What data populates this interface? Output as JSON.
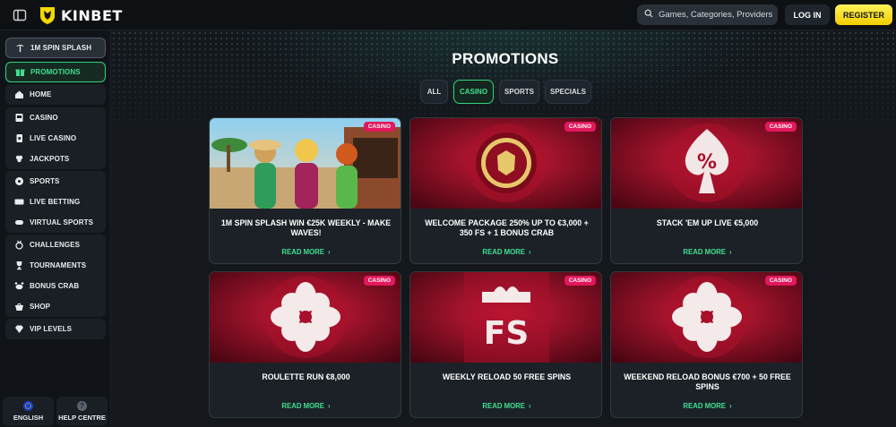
{
  "header": {
    "brand": "KINBET",
    "search_placeholder": "Games, Categories, Providers",
    "login_label": "LOG IN",
    "register_label": "REGISTER"
  },
  "sidebar": {
    "items": [
      {
        "label": "1M SPIN SPLASH",
        "icon": "palm-icon"
      },
      {
        "label": "PROMOTIONS",
        "icon": "gift-icon"
      },
      {
        "label": "HOME",
        "icon": "home-icon"
      },
      {
        "label": "CASINO",
        "icon": "slot-icon"
      },
      {
        "label": "LIVE CASINO",
        "icon": "cards-icon"
      },
      {
        "label": "JACKPOTS",
        "icon": "clover-icon"
      },
      {
        "label": "SPORTS",
        "icon": "ball-icon"
      },
      {
        "label": "LIVE BETTING",
        "icon": "live-icon"
      },
      {
        "label": "VIRTUAL SPORTS",
        "icon": "controller-icon"
      },
      {
        "label": "CHALLENGES",
        "icon": "medal-icon"
      },
      {
        "label": "TOURNAMENTS",
        "icon": "trophy-icon"
      },
      {
        "label": "BONUS CRAB",
        "icon": "crab-icon"
      },
      {
        "label": "SHOP",
        "icon": "basket-icon"
      },
      {
        "label": "VIP LEVELS",
        "icon": "diamond-icon"
      }
    ],
    "footer": {
      "language_label": "ENGLISH",
      "help_label": "HELP CENTRE"
    }
  },
  "main": {
    "title": "PROMOTIONS",
    "filters": [
      "ALL",
      "CASINO",
      "SPORTS",
      "SPECIALS"
    ],
    "active_filter": "CASINO",
    "read_more_label": "READ MORE",
    "cards": [
      {
        "badge": "CASINO",
        "title": "1M SPIN SPLASH WIN €25K WEEKLY - MAKE WAVES!",
        "art": "characters"
      },
      {
        "badge": "CASINO",
        "title": "WELCOME PACKAGE 250% UP TO €3,000 + 350 FS + 1 BONUS CRAB",
        "art": "chip"
      },
      {
        "badge": "CASINO",
        "title": "STACK 'EM UP LIVE €5,000",
        "art": "percent-spade"
      },
      {
        "badge": "CASINO",
        "title": "ROULETTE RUN €8,000",
        "art": "flower"
      },
      {
        "badge": "CASINO",
        "title": "WEEKLY RELOAD 50 FREE SPINS",
        "art": "fs-gift"
      },
      {
        "badge": "CASINO",
        "title": "WEEKEND RELOAD BONUS €700 + 50 FREE SPINS",
        "art": "flower"
      }
    ]
  },
  "colors": {
    "accent_green": "#3fe08f",
    "register_yellow": "#f2cd00",
    "badge_pink": "#e2175d",
    "promo_red": "#b5122f"
  }
}
